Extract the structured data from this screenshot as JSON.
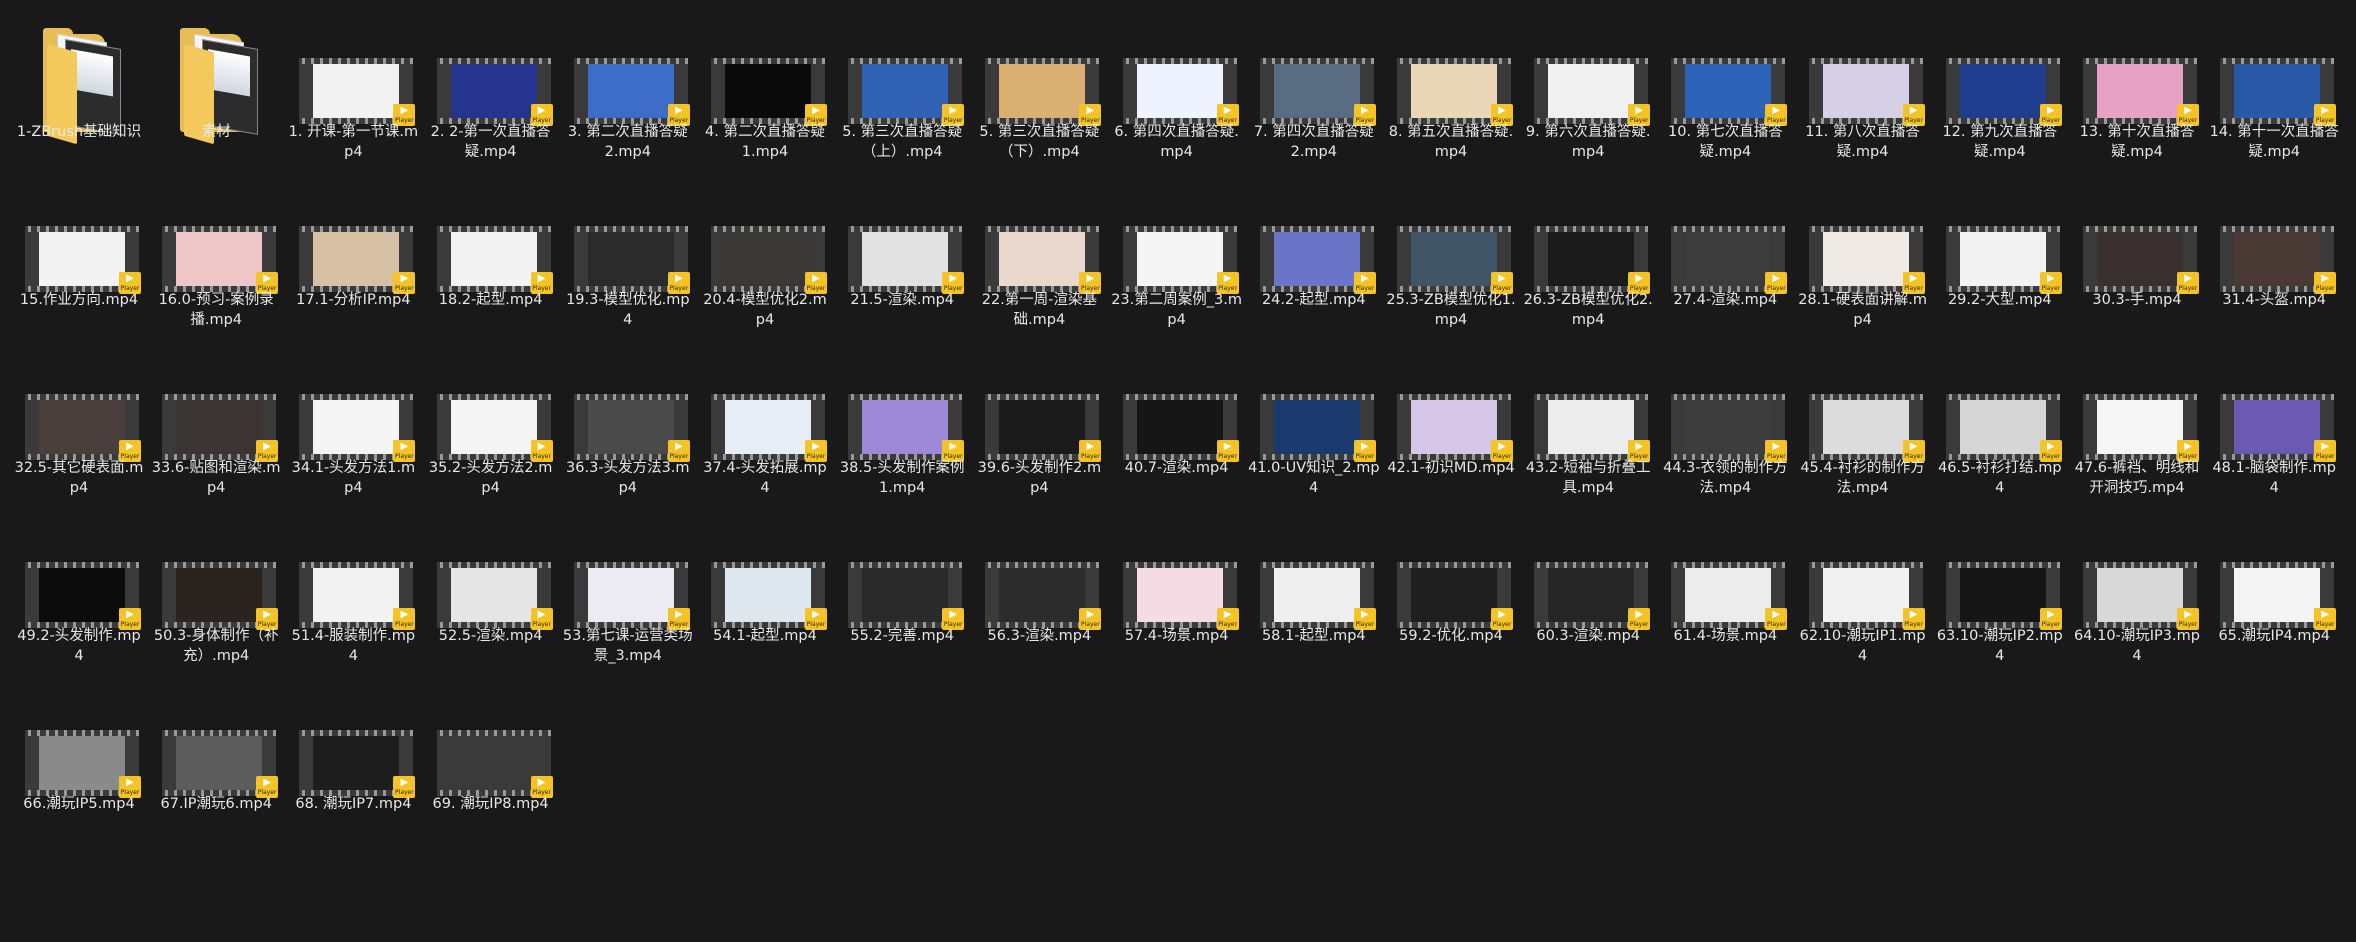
{
  "folders": [
    {
      "label": "1-ZBrush基础知识",
      "icon": "folder-icon"
    },
    {
      "label": "素材",
      "icon": "folder-icon"
    }
  ],
  "badge_text": "Player",
  "files": [
    {
      "label": "1. 开课-第一节课.mp4",
      "thumb": "#f2f2f2"
    },
    {
      "label": "2. 2-第一次直播答疑.mp4",
      "thumb": "#27348f"
    },
    {
      "label": "3. 第二次直播答疑2.mp4",
      "thumb": "#3d6cc9"
    },
    {
      "label": "4. 第二次直播答疑1.mp4",
      "thumb": "#0a0a0a"
    },
    {
      "label": "5. 第三次直播答疑（上）.mp4",
      "thumb": "#3161b5"
    },
    {
      "label": "5. 第三次直播答疑（下）.mp4",
      "thumb": "#d9b071"
    },
    {
      "label": "6. 第四次直播答疑.mp4",
      "thumb": "#eef3ff"
    },
    {
      "label": "7. 第四次直播答疑2.mp4",
      "thumb": "#5a6c82"
    },
    {
      "label": "8. 第五次直播答疑.mp4",
      "thumb": "#e9d7b8"
    },
    {
      "label": "9. 第六次直播答疑.mp4",
      "thumb": "#f1f1f1"
    },
    {
      "label": "10. 第七次直播答疑.mp4",
      "thumb": "#2c62b8"
    },
    {
      "label": "11. 第八次直播答疑.mp4",
      "thumb": "#d5d0e6"
    },
    {
      "label": "12. 第九次直播答疑.mp4",
      "thumb": "#1f3f8e"
    },
    {
      "label": "13. 第十次直播答疑.mp4",
      "thumb": "#e6a1c4"
    },
    {
      "label": "14. 第十一次直播答疑.mp4",
      "thumb": "#2a58a8"
    },
    {
      "label": "15.作业方向.mp4",
      "thumb": "#f3f3f3"
    },
    {
      "label": "16.0-预习-案例录播.mp4",
      "thumb": "#f0c7c9"
    },
    {
      "label": "17.1-分析IP.mp4",
      "thumb": "#d7c1a5"
    },
    {
      "label": "18.2-起型.mp4",
      "thumb": "#f3f3f3"
    },
    {
      "label": "19.3-模型优化.mp4",
      "thumb": "#2b2b2b"
    },
    {
      "label": "20.4-模型优化2.mp4",
      "thumb": "#3a3835"
    },
    {
      "label": "21.5-渲染.mp4",
      "thumb": "#e2e2e2"
    },
    {
      "label": "22.第一周-渲染基础.mp4",
      "thumb": "#ead8cf"
    },
    {
      "label": "23.第二周案例_3.mp4",
      "thumb": "#f5f5f5"
    },
    {
      "label": "24.2-起型.mp4",
      "thumb": "#6a75c8"
    },
    {
      "label": "25.3-ZB模型优化1.mp4",
      "thumb": "#405566"
    },
    {
      "label": "26.3-ZB模型优化2.mp4",
      "thumb": "#1b1b1b"
    },
    {
      "label": "27.4-渲染.mp4",
      "thumb": "#3c3c3c"
    },
    {
      "label": "28.1-硬表面讲解.mp4",
      "thumb": "#efe9e6"
    },
    {
      "label": "29.2-大型.mp4",
      "thumb": "#f2f2f2"
    },
    {
      "label": "30.3-手.mp4",
      "thumb": "#3a3030"
    },
    {
      "label": "31.4-头盔.mp4",
      "thumb": "#4a3a36"
    },
    {
      "label": "32.5-其它硬表面.mp4",
      "thumb": "#4a3f3c"
    },
    {
      "label": "33.6-贴图和渲染.mp4",
      "thumb": "#3b3534"
    },
    {
      "label": "34.1-头发方法1.mp4",
      "thumb": "#f4f4f4"
    },
    {
      "label": "35.2-头发方法2.mp4",
      "thumb": "#f4f4f4"
    },
    {
      "label": "36.3-头发方法3.mp4",
      "thumb": "#4a4a4a"
    },
    {
      "label": "37.4-头发拓展.mp4",
      "thumb": "#e7eef7"
    },
    {
      "label": "38.5-头发制作案例1.mp4",
      "thumb": "#9d8ad6"
    },
    {
      "label": "39.6-头发制作2.mp4",
      "thumb": "#1a1a1a"
    },
    {
      "label": "40.7-渲染.mp4",
      "thumb": "#161616"
    },
    {
      "label": "41.0-UV知识_2.mp4",
      "thumb": "#1b3a6e"
    },
    {
      "label": "42.1-初识MD.mp4",
      "thumb": "#d5c6e6"
    },
    {
      "label": "43.2-短袖与折叠工具.mp4",
      "thumb": "#ededed"
    },
    {
      "label": "44.3-衣领的制作方法.mp4",
      "thumb": "#3d3d3d"
    },
    {
      "label": "45.4-衬衫的制作方法.mp4",
      "thumb": "#dcdcdc"
    },
    {
      "label": "46.5-衬衫打结.mp4",
      "thumb": "#d6d6d6"
    },
    {
      "label": "47.6-裤裆、明线和开洞技巧.mp4",
      "thumb": "#f6f6f6"
    },
    {
      "label": "48.1-脑袋制作.mp4",
      "thumb": "#6b5ab3"
    },
    {
      "label": "49.2-头发制作.mp4",
      "thumb": "#0c0c0c"
    },
    {
      "label": "50.3-身体制作（补充）.mp4",
      "thumb": "#2a2320"
    },
    {
      "label": "51.4-服装制作.mp4",
      "thumb": "#f2f2f2"
    },
    {
      "label": "52.5-渲染.mp4",
      "thumb": "#e6e6e6"
    },
    {
      "label": "53.第七课-运营类场景_3.mp4",
      "thumb": "#eceaf2"
    },
    {
      "label": "54.1-起型.mp4",
      "thumb": "#dfe7ef"
    },
    {
      "label": "55.2-完善.mp4",
      "thumb": "#2a2a2a"
    },
    {
      "label": "56.3-渲染.mp4",
      "thumb": "#2c2c2c"
    },
    {
      "label": "57.4-场景.mp4",
      "thumb": "#f4dbe4"
    },
    {
      "label": "58.1-起型.mp4",
      "thumb": "#efefef"
    },
    {
      "label": "59.2-优化.mp4",
      "thumb": "#1f1f1f"
    },
    {
      "label": "60.3-渲染.mp4",
      "thumb": "#262626"
    },
    {
      "label": "61.4-场景.mp4",
      "thumb": "#ececec"
    },
    {
      "label": "62.10-潮玩IP1.mp4",
      "thumb": "#f1f1f1"
    },
    {
      "label": "63.10-潮玩IP2.mp4",
      "thumb": "#151515"
    },
    {
      "label": "64.10-潮玩IP3.mp4",
      "thumb": "#d8d8d8"
    },
    {
      "label": "65.潮玩IP4.mp4",
      "thumb": "#f4f4f4"
    },
    {
      "label": "66.潮玩IP5.mp4",
      "thumb": "#8a8a8a"
    },
    {
      "label": "67.IP潮玩6.mp4",
      "thumb": "#5c5c5c"
    },
    {
      "label": "68. 潮玩IP7.mp4",
      "thumb": "#1d1d1d"
    },
    {
      "label": "69. 潮玩IP8.mp4",
      "thumb": "#3a3a3a"
    }
  ]
}
